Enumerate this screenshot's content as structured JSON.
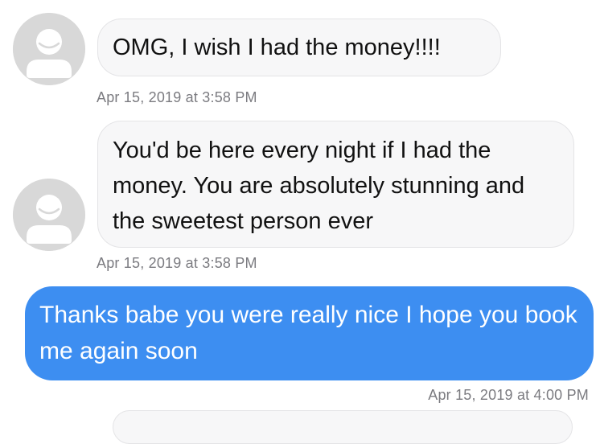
{
  "messages": [
    {
      "direction": "incoming",
      "text": "OMG, I wish I had the money!!!!",
      "timestamp": "Apr 15, 2019 at 3:58 PM"
    },
    {
      "direction": "incoming",
      "text": "You'd be here every night if I had the money. You are absolutely stunning and the sweetest person ever",
      "timestamp": "Apr 15, 2019 at 3:58 PM"
    },
    {
      "direction": "outgoing",
      "text": "Thanks babe you were really nice I hope you book me again soon",
      "timestamp": "Apr 15, 2019 at 4:00 PM"
    }
  ],
  "icons": {
    "avatar": "person-placeholder-icon"
  },
  "colors": {
    "outgoing_bubble": "#3d8ef1",
    "incoming_bubble": "#f7f7f8",
    "timestamp": "#7b7b80",
    "avatar": "#d8d8d8"
  }
}
